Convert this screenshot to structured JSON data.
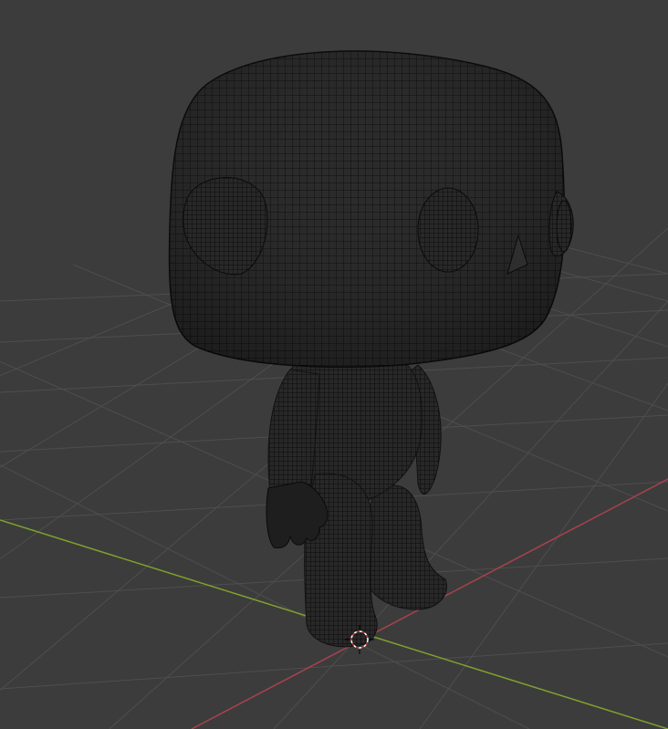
{
  "viewport": {
    "mode": "wireframe-overlay",
    "background_color": "#3c3c3c",
    "grid_color": "#4d4d4d",
    "x_axis_color": "#a8424d",
    "y_axis_color": "#7ea22c",
    "mesh_fill_color": "#2c2c2c",
    "wire_color": "#0f0f0f",
    "cursor_outer_color": "#ffffff",
    "cursor_inner_color": "#c23b3b"
  },
  "scene": {
    "object_name": "pop-figure-mesh",
    "parts": [
      "head",
      "left-ear",
      "right-ear",
      "left-eye",
      "right-eye",
      "nose",
      "torso",
      "left-arm",
      "left-hand",
      "right-arm",
      "left-leg",
      "right-leg"
    ]
  }
}
